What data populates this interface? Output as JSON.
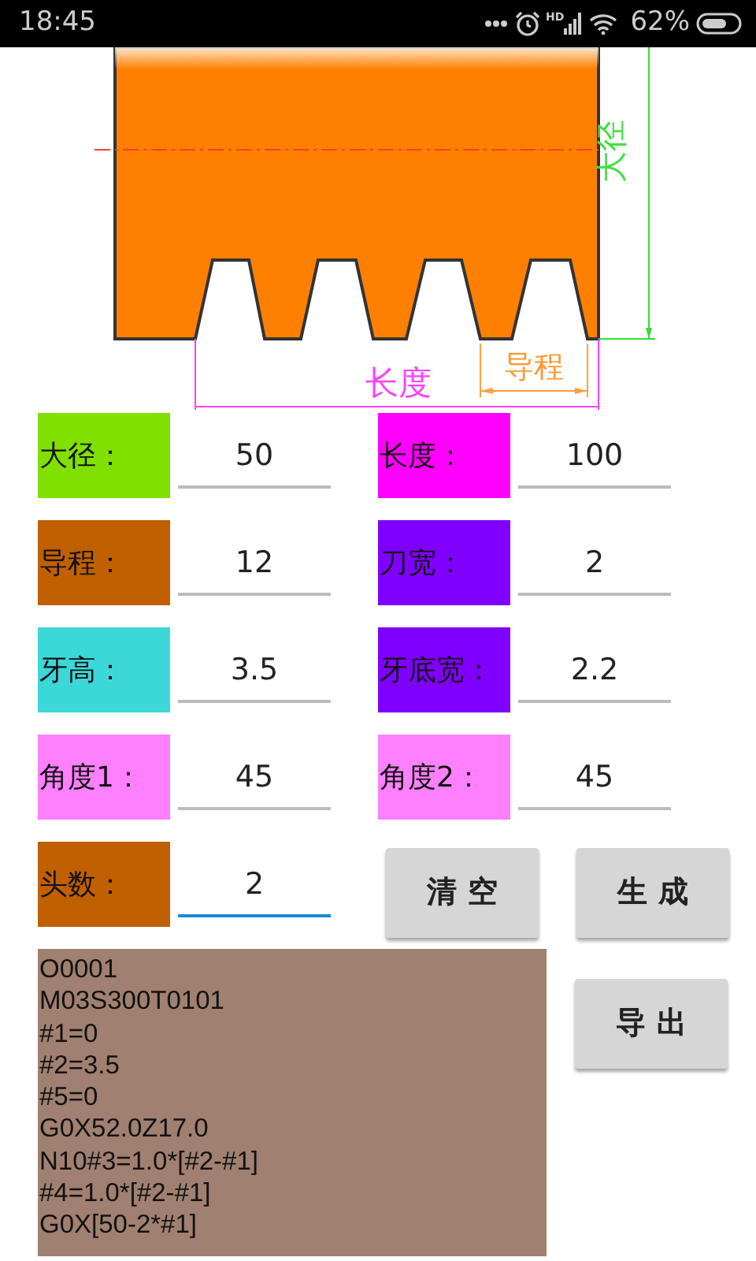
{
  "status_bar": {
    "time": "18:45",
    "signal_badge": "HD",
    "battery": "62%"
  },
  "diagram": {
    "labels": [
      {
        "text": "大径",
        "kind": "major"
      },
      {
        "text": "长度",
        "kind": "length"
      },
      {
        "text": "导程",
        "kind": "lead"
      }
    ]
  },
  "fields": [
    {
      "label": "大径：",
      "color": "#80e000",
      "value": "50",
      "focused": false
    },
    {
      "label": "长度：",
      "color": "#ff00ff",
      "value": "100",
      "focused": false
    },
    {
      "label": "导程：",
      "color": "#c06000",
      "value": "12",
      "focused": false
    },
    {
      "label": "刀宽：",
      "color": "#8000ff",
      "value": "2",
      "focused": false
    },
    {
      "label": "牙高：",
      "color": "#3cd8d8",
      "value": "3.5",
      "focused": false
    },
    {
      "label": "牙底宽：",
      "color": "#8000ff",
      "value": "2.2",
      "focused": false
    },
    {
      "label": "角度1：",
      "color": "#ff80ff",
      "value": "45",
      "focused": false
    },
    {
      "label": "角度2：",
      "color": "#ff80ff",
      "value": "45",
      "focused": false
    },
    {
      "label": "头数：",
      "color": "#c06000",
      "value": "2",
      "focused": true
    }
  ],
  "buttons": [
    {
      "label": "清 空"
    },
    {
      "label": "生 成"
    },
    {
      "label": "导 出"
    }
  ],
  "output": {
    "lines": [
      "O0001",
      "M03S300T0101",
      "#1=0",
      "#2=3.5",
      "#5=0",
      "G0X52.0Z17.0",
      "N10#3=1.0*[#2-#1]",
      "#4=1.0*[#2-#1]",
      "G0X[50-2*#1]"
    ]
  }
}
